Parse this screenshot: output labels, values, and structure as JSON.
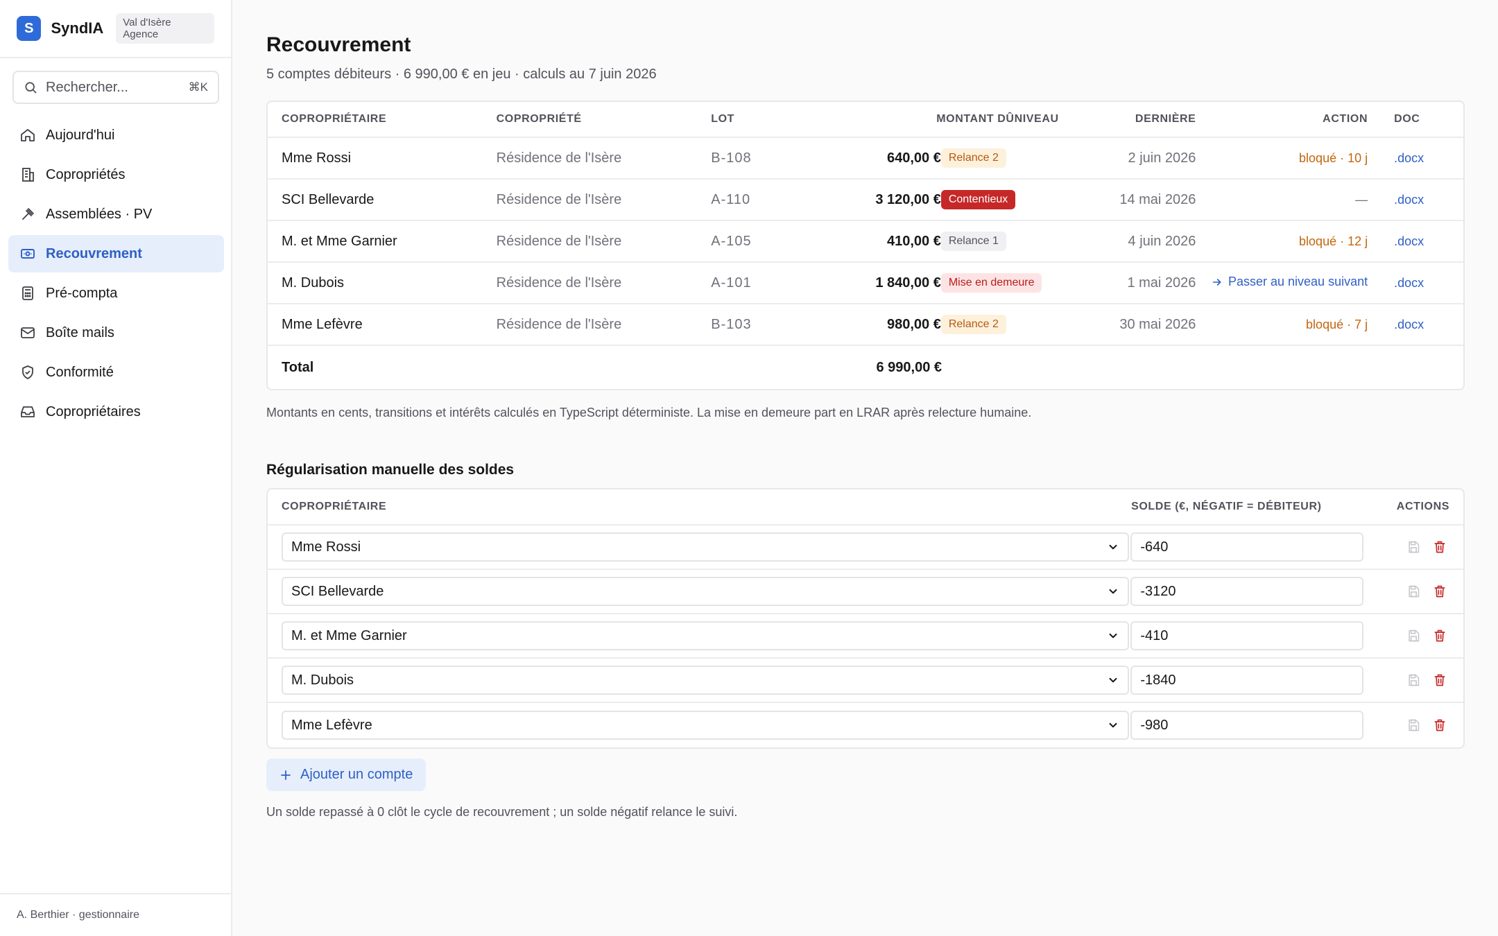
{
  "brand": {
    "logo_letter": "S",
    "name": "SyndIA",
    "agency": "Val d'Isère Agence"
  },
  "search": {
    "placeholder": "Rechercher...",
    "shortcut": "⌘K"
  },
  "nav": [
    {
      "label": "Aujourd'hui",
      "icon": "home-icon"
    },
    {
      "label": "Copropriétés",
      "icon": "building-icon"
    },
    {
      "label": "Assemblées · PV",
      "icon": "gavel-icon"
    },
    {
      "label": "Recouvrement",
      "icon": "banknote-icon",
      "active": true
    },
    {
      "label": "Pré-compta",
      "icon": "calculator-icon"
    },
    {
      "label": "Boîte mails",
      "icon": "mail-icon"
    },
    {
      "label": "Conformité",
      "icon": "shield-check-icon"
    },
    {
      "label": "Copropriétaires",
      "icon": "inbox-icon"
    }
  ],
  "user": "A. Berthier · gestionnaire",
  "page": {
    "title": "Recouvrement",
    "subtitle": "5 comptes débiteurs · 6 990,00 € en jeu · calculs au 7 juin 2026"
  },
  "table": {
    "headers": {
      "name": "Copropriétaire",
      "copro": "Copropriété",
      "lot": "Lot",
      "amount": "Montant DûNiveau",
      "last": "Dernière",
      "action": "Action",
      "doc": "Doc"
    },
    "rows": [
      {
        "name": "Mme Rossi",
        "copro": "Résidence de l'Isère",
        "lot": "B-108",
        "amount": "640,00 €",
        "niveau": "Relance 2",
        "niveau_style": "orange",
        "last": "2 juin 2026",
        "action": "bloqué · 10 j",
        "action_type": "blocked",
        "doc": ".docx"
      },
      {
        "name": "SCI Bellevarde",
        "copro": "Résidence de l'Isère",
        "lot": "A-110",
        "amount": "3 120,00 €",
        "niveau": "Contentieux",
        "niveau_style": "red",
        "last": "14 mai 2026",
        "action": "—",
        "action_type": "none",
        "doc": ".docx"
      },
      {
        "name": "M. et Mme Garnier",
        "copro": "Résidence de l'Isère",
        "lot": "A-105",
        "amount": "410,00 €",
        "niveau": "Relance 1",
        "niveau_style": "gray",
        "last": "4 juin 2026",
        "action": "bloqué · 12 j",
        "action_type": "blocked",
        "doc": ".docx"
      },
      {
        "name": "M. Dubois",
        "copro": "Résidence de l'Isère",
        "lot": "A-101",
        "amount": "1 840,00 €",
        "niveau": "Mise en demeure",
        "niveau_style": "pink",
        "last": "1 mai 2026",
        "action": "Passer au niveau suivant",
        "action_type": "link",
        "doc": ".docx"
      },
      {
        "name": "Mme Lefèvre",
        "copro": "Résidence de l'Isère",
        "lot": "B-103",
        "amount": "980,00 €",
        "niveau": "Relance 2",
        "niveau_style": "orange",
        "last": "30 mai 2026",
        "action": "bloqué · 7 j",
        "action_type": "blocked",
        "doc": ".docx"
      }
    ],
    "total_label": "Total",
    "total_amount": "6 990,00 €"
  },
  "note": "Montants en cents, transitions et intérêts calculés en TypeScript déterministe. La mise en demeure part en LRAR après relecture humaine.",
  "regularisation": {
    "title": "Régularisation manuelle des soldes",
    "headers": {
      "who": "Copropriétaire",
      "solde": "Solde (€, négatif = débiteur)",
      "actions": "Actions"
    },
    "rows": [
      {
        "who": "Mme Rossi",
        "solde": "-640"
      },
      {
        "who": "SCI Bellevarde",
        "solde": "-3120"
      },
      {
        "who": "M. et Mme Garnier",
        "solde": "-410"
      },
      {
        "who": "M. Dubois",
        "solde": "-1840"
      },
      {
        "who": "Mme Lefèvre",
        "solde": "-980"
      }
    ],
    "add_label": "Ajouter un compte",
    "footer_note": "Un solde repassé à 0 clôt le cycle de recouvrement ; un solde négatif relance le suivi."
  },
  "colors": {
    "accent": "#2f6bd8",
    "danger": "#c62828",
    "warning": "#c2660e"
  }
}
